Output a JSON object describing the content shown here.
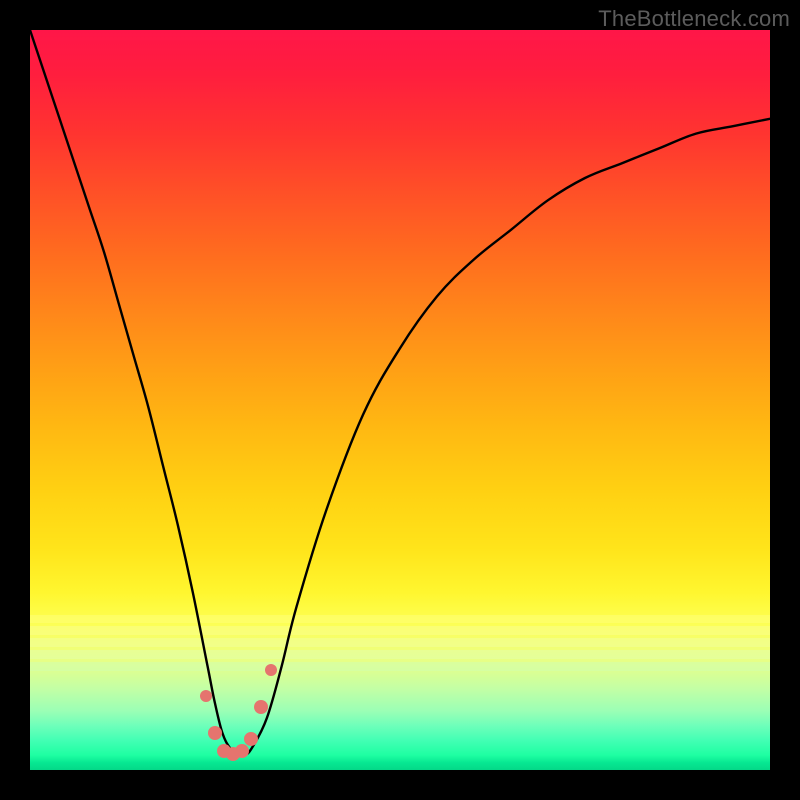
{
  "watermark": "TheBottleneck.com",
  "colors": {
    "page_background": "#000000",
    "gradient_top": "#ff1648",
    "gradient_bottom": "#04d888",
    "curve_stroke": "#000000",
    "marker_fill": "#e5746e",
    "watermark_text": "#5c5c5c"
  },
  "chart_data": {
    "type": "line",
    "title": "",
    "xlabel": "",
    "ylabel": "",
    "xlim": [
      0,
      100
    ],
    "ylim": [
      0,
      100
    ],
    "grid": false,
    "legend_position": "none",
    "annotations": [
      "TheBottleneck.com"
    ],
    "series": [
      {
        "name": "bottleneck-curve",
        "x": [
          0,
          2,
          4,
          6,
          8,
          10,
          12,
          14,
          16,
          18,
          20,
          22,
          24,
          25,
          26,
          27,
          28,
          29,
          30,
          32,
          34,
          36,
          40,
          45,
          50,
          55,
          60,
          65,
          70,
          75,
          80,
          85,
          90,
          95,
          100
        ],
        "y": [
          100,
          94,
          88,
          82,
          76,
          70,
          63,
          56,
          49,
          41,
          33,
          24,
          14,
          9,
          5,
          3,
          2,
          2,
          3,
          7,
          14,
          22,
          35,
          48,
          57,
          64,
          69,
          73,
          77,
          80,
          82,
          84,
          86,
          87,
          88
        ]
      }
    ],
    "markers": [
      {
        "x": 23.8,
        "y": 10.0
      },
      {
        "x": 25.0,
        "y": 5.0
      },
      {
        "x": 26.2,
        "y": 2.6
      },
      {
        "x": 27.4,
        "y": 2.2
      },
      {
        "x": 28.6,
        "y": 2.6
      },
      {
        "x": 29.8,
        "y": 4.2
      },
      {
        "x": 31.2,
        "y": 8.5
      },
      {
        "x": 32.6,
        "y": 13.5
      }
    ],
    "background_gradient": {
      "type": "vertical",
      "stops": [
        {
          "pos": 0.0,
          "color": "#ff1648"
        },
        {
          "pos": 0.3,
          "color": "#ff6b1f"
        },
        {
          "pos": 0.62,
          "color": "#ffd012"
        },
        {
          "pos": 0.8,
          "color": "#fdff52"
        },
        {
          "pos": 0.92,
          "color": "#9bffb5"
        },
        {
          "pos": 1.0,
          "color": "#04d888"
        }
      ]
    }
  }
}
